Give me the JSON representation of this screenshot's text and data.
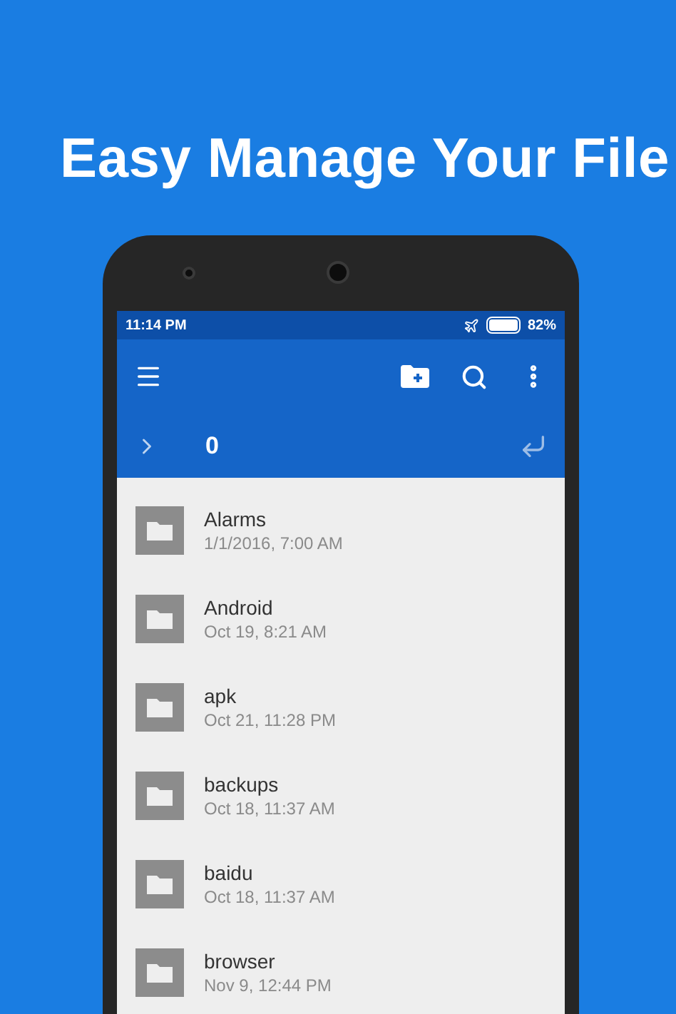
{
  "headline": "Easy Manage Your File",
  "status_bar": {
    "time": "11:14 PM",
    "battery": "82%"
  },
  "path_bar": {
    "path": "0"
  },
  "files": [
    {
      "name": "Alarms",
      "modified": "1/1/2016, 7:00 AM"
    },
    {
      "name": "Android",
      "modified": "Oct 19, 8:21 AM"
    },
    {
      "name": "apk",
      "modified": "Oct 21, 11:28 PM"
    },
    {
      "name": "backups",
      "modified": "Oct 18, 11:37 AM"
    },
    {
      "name": "baidu",
      "modified": "Oct 18, 11:37 AM"
    },
    {
      "name": "browser",
      "modified": "Nov 9, 12:44 PM"
    }
  ]
}
